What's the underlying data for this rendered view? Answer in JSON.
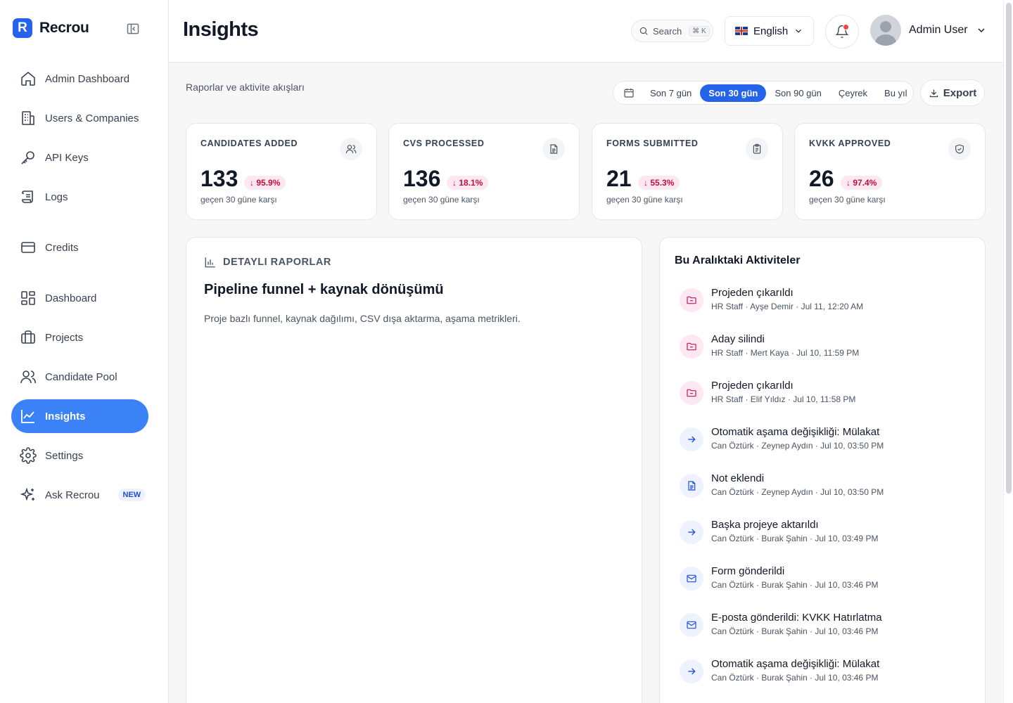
{
  "brand": {
    "letter": "R",
    "name": "Recrou"
  },
  "sidebar": {
    "items": [
      {
        "label": "Admin Dashboard"
      },
      {
        "label": "Users & Companies"
      },
      {
        "label": "API Keys"
      },
      {
        "label": "Logs"
      },
      {
        "label": "Credits"
      },
      {
        "label": "Dashboard"
      },
      {
        "label": "Projects"
      },
      {
        "label": "Candidate Pool"
      },
      {
        "label": "Insights",
        "active": true
      },
      {
        "label": "Settings"
      },
      {
        "label": "Ask Recrou",
        "badge": "NEW"
      }
    ]
  },
  "header": {
    "title": "Insights",
    "search_label": "Search",
    "search_shortcut": "⌘ K",
    "language": "English",
    "user_name": "Admin User"
  },
  "toolbar": {
    "subtitle": "Raporlar ve aktivite akışları",
    "ranges": [
      "Son 7 gün",
      "Son 30 gün",
      "Son 90 gün",
      "Çeyrek",
      "Bu yıl"
    ],
    "active_range": "Son 30 gün",
    "export_label": "Export"
  },
  "stats": [
    {
      "label": "CANDIDATES ADDED",
      "value": "133",
      "delta": "95.9%",
      "caption": "geçen 30 güne karşı",
      "icon": "users-icon"
    },
    {
      "label": "CVS PROCESSED",
      "value": "136",
      "delta": "18.1%",
      "caption": "geçen 30 güne karşı",
      "icon": "document-icon"
    },
    {
      "label": "FORMS SUBMITTED",
      "value": "21",
      "delta": "55.3%",
      "caption": "geçen 30 güne karşı",
      "icon": "clipboard-icon"
    },
    {
      "label": "KVKK APPROVED",
      "value": "26",
      "delta": "97.4%",
      "caption": "geçen 30 güne karşı",
      "icon": "shield-check-icon"
    }
  ],
  "reports": {
    "kicker": "DETAYLI RAPORLAR",
    "title": "Pipeline funnel + kaynak dönüşümü",
    "description": "Proje bazlı funnel, kaynak dağılımı, CSV dışa aktarma, aşama metrikleri."
  },
  "activity": {
    "title": "Bu Aralıktaki Aktiviteler",
    "items": [
      {
        "title": "Projeden çıkarıldı",
        "meta": "HR Staff · Ayşe Demir · Jul 11, 12:20 AM",
        "icon": "folder-remove-icon",
        "tone": "pink"
      },
      {
        "title": "Aday silindi",
        "meta": "HR Staff · Mert Kaya · Jul 10, 11:59 PM",
        "icon": "folder-remove-icon",
        "tone": "pink"
      },
      {
        "title": "Projeden çıkarıldı",
        "meta": "HR Staff · Elif Yıldız · Jul 10, 11:58 PM",
        "icon": "folder-remove-icon",
        "tone": "pink"
      },
      {
        "title": "Otomatik aşama değişikliği: Mülakat",
        "meta": "Can Öztürk · Zeynep Aydın · Jul 10, 03:50 PM",
        "icon": "arrow-right-icon",
        "tone": "blue"
      },
      {
        "title": "Not eklendi",
        "meta": "Can Öztürk · Zeynep Aydın · Jul 10, 03:50 PM",
        "icon": "note-icon",
        "tone": "blue"
      },
      {
        "title": "Başka projeye aktarıldı",
        "meta": "Can Öztürk · Burak Şahin · Jul 10, 03:49 PM",
        "icon": "arrow-right-icon",
        "tone": "blue"
      },
      {
        "title": "Form gönderildi",
        "meta": "Can Öztürk · Burak Şahin · Jul 10, 03:46 PM",
        "icon": "mail-icon",
        "tone": "blue"
      },
      {
        "title": "E-posta gönderildi: KVKK Hatırlatma",
        "meta": "Can Öztürk · Burak Şahin · Jul 10, 03:46 PM",
        "icon": "mail-icon",
        "tone": "blue"
      },
      {
        "title": "Otomatik aşama değişikliği: Mülakat",
        "meta": "Can Öztürk · Burak Şahin · Jul 10, 03:46 PM",
        "icon": "arrow-right-icon",
        "tone": "blue"
      }
    ]
  },
  "colors": {
    "accent": "#2563eb",
    "active_nav": "#3b82f6",
    "delta_bg": "#fce7f3",
    "delta_text": "#be123c"
  }
}
